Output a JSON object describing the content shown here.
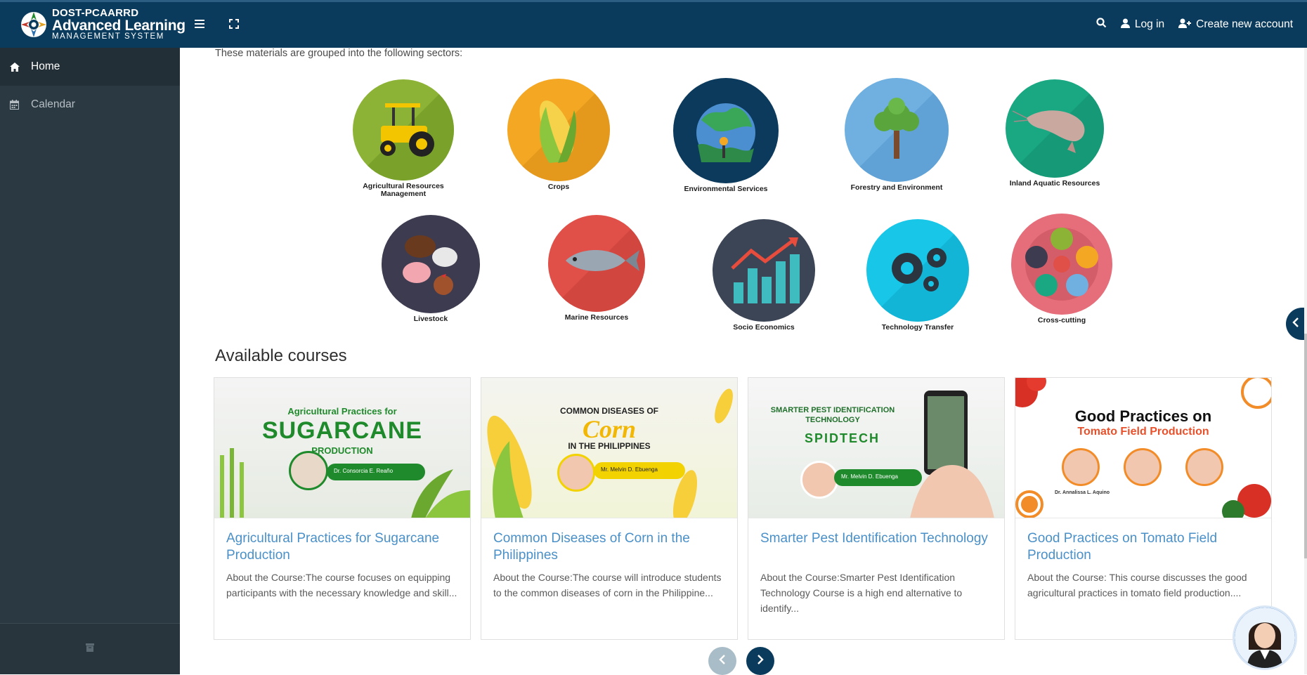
{
  "navbar": {
    "brand_line1": "DOST-PCAARRD",
    "brand_line2": "Advanced Learning",
    "brand_line3": "MANAGEMENT SYSTEM",
    "login_label": "Log in",
    "create_account_label": "Create new account",
    "icons": [
      "menu-icon",
      "fullscreen-icon",
      "search-icon",
      "user-icon",
      "user-plus-icon"
    ]
  },
  "sidebar": {
    "items": [
      {
        "label": "Home",
        "icon": "home-icon",
        "active": true
      },
      {
        "label": "Calendar",
        "icon": "calendar-icon",
        "active": false
      }
    ]
  },
  "main": {
    "intro_text": "These materials are grouped into the following sectors:",
    "sectors": [
      {
        "label": "Agricultural Resources Management",
        "color": "#8db336"
      },
      {
        "label": "Crops",
        "color": "#f4a722"
      },
      {
        "label": "Environmental Services",
        "color": "#0b3a5c"
      },
      {
        "label": "Forestry and Environment",
        "color": "#6fb0e0"
      },
      {
        "label": "Inland Aquatic Resources",
        "color": "#1aa883"
      },
      {
        "label": "Livestock",
        "color": "#3d3b4f"
      },
      {
        "label": "Marine Resources",
        "color": "#e05048"
      },
      {
        "label": "Socio Economics",
        "color": "#3c4556"
      },
      {
        "label": "Technology Transfer",
        "color": "#18c6e8"
      },
      {
        "label": "Cross-cutting",
        "color": "#e66d7a"
      }
    ],
    "available_courses_heading": "Available courses",
    "courses": [
      {
        "title": "Agricultural Practices for Sugarcane Production",
        "description": "About the Course:The course focuses on equipping participants with the necessary knowledge and skill...",
        "banner_line1": "Agricultural Practices for",
        "banner_line2": "SUGARCANE",
        "banner_line3": "PRODUCTION",
        "speaker": "Dr. Consorcia E. Reaño"
      },
      {
        "title": "Common Diseases of Corn in the Philippines",
        "description": "About the Course:The course will introduce students to the common diseases of corn in the Philippine...",
        "banner_line1": "COMMON DISEASES OF",
        "banner_line2": "Corn",
        "banner_line3": "IN THE PHILIPPINES",
        "speaker": "Mr. Melvin D. Ebuenga"
      },
      {
        "title": "Smarter Pest Identification Technology",
        "description": "About the Course:Smarter Pest Identification Technology Course is a high end alternative to identify...",
        "banner_line1": "SMARTER PEST IDENTIFICATION",
        "banner_line2": "TECHNOLOGY",
        "banner_line3": "SPIDTECH",
        "speaker": "Mr. Melvin D. Ebuenga"
      },
      {
        "title": "Good Practices on Tomato Field Production",
        "description": "About the Course: This course discusses the good agricultural practices in tomato field production....",
        "banner_line1": "Good Practices on",
        "banner_line2": "Tomato Field Production",
        "banner_line3": "",
        "speaker": "Dr. Annalissa L. Aquino"
      }
    ]
  },
  "colors": {
    "navbar": "#0a3b5c",
    "sidebar": "#2b3a42",
    "link": "#4a90c8",
    "accent_green": "#1f8a2b"
  }
}
